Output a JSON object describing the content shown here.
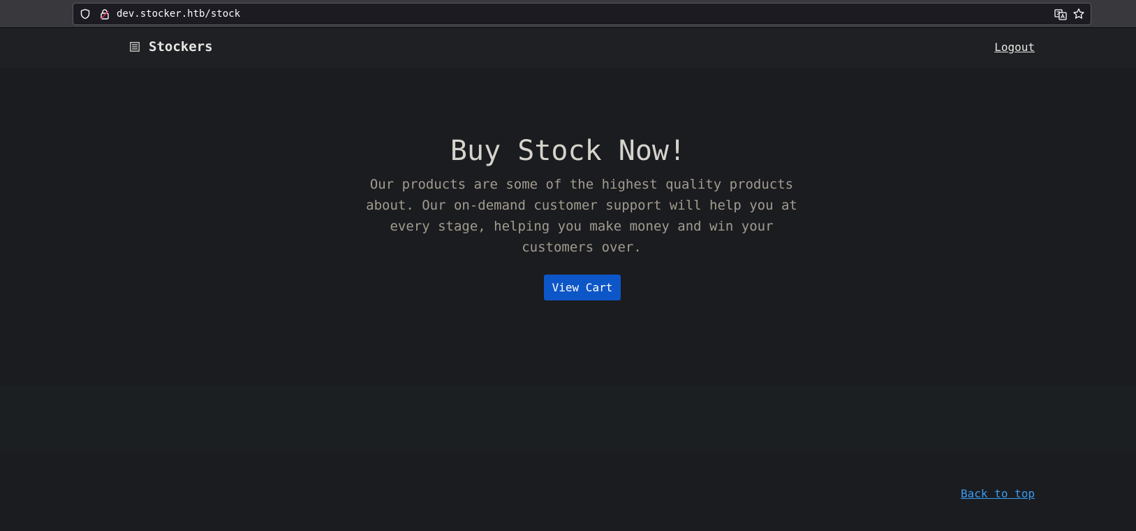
{
  "browser": {
    "url": "dev.stocker.htb/stock"
  },
  "header": {
    "brand": "Stockers",
    "logout_label": "Logout"
  },
  "hero": {
    "title": "Buy Stock Now!",
    "lead": "Our products are some of the highest quality products about. Our on-demand customer support will help you at every stage, helping you make money and win your customers over.",
    "cta_label": "View Cart"
  },
  "footer": {
    "back_to_top_label": "Back to top"
  },
  "colors": {
    "background": "#1b1c1f",
    "header_background": "#1e2023",
    "button": "#0d56c8",
    "link": "#3a9bf3"
  },
  "icons": {
    "url_left": [
      "shield-icon",
      "lock-icon"
    ],
    "url_right": [
      "translate-icon",
      "star-icon"
    ],
    "brand": "document-icon"
  }
}
